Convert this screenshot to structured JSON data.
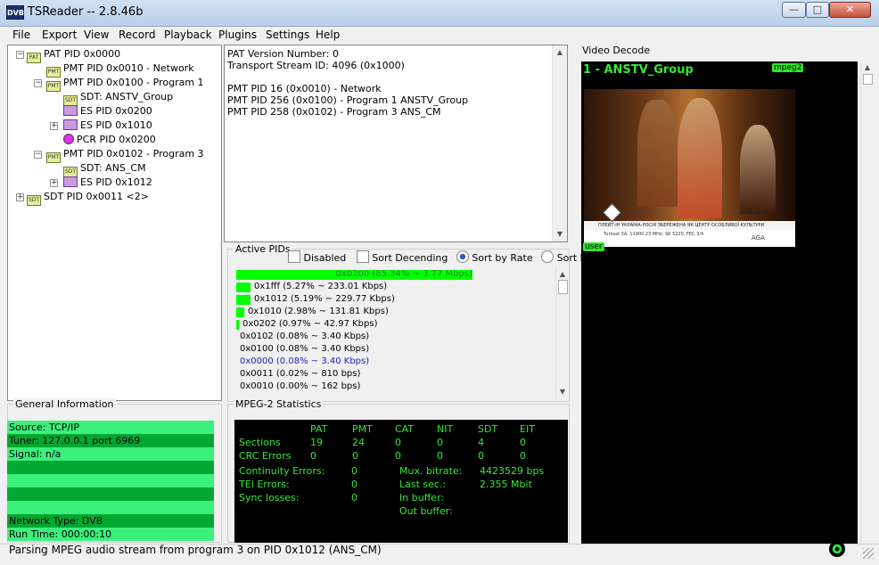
{
  "window": {
    "title": "TSReader -- 2.8.46b",
    "icon_text": "DVB"
  },
  "menu": [
    "File",
    "Export",
    "View",
    "Record",
    "Playback",
    "Plugins",
    "Settings",
    "Help"
  ],
  "tree": [
    {
      "label": "PAT PID 0x0000",
      "icon": "PAT"
    },
    {
      "label": "PMT PID 0x0010 - Network",
      "icon": "PMT"
    },
    {
      "label": "PMT PID 0x0100 - Program 1",
      "icon": "PMT"
    },
    {
      "label": "SDT: ANSTV_Group",
      "icon": "SDT"
    },
    {
      "label": "ES PID 0x0200",
      "icon": "ES"
    },
    {
      "label": "ES PID 0x1010",
      "icon": "ES"
    },
    {
      "label": "PCR PID 0x0200",
      "icon": "PCR"
    },
    {
      "label": "PMT PID 0x0102 - Program 3",
      "icon": "PMT"
    },
    {
      "label": "SDT: ANS_CM",
      "icon": "SDT"
    },
    {
      "label": "ES PID 0x1012",
      "icon": "ES"
    },
    {
      "label": "SDT PID 0x0011 <2>",
      "icon": "SDT"
    }
  ],
  "info": [
    "PAT Version Number: 0",
    "Transport Stream ID: 4096 (0x1000)",
    "",
    "PMT PID 16 (0x0010) - Network",
    "PMT PID 256 (0x0100) - Program 1 ANSTV_Group",
    "PMT PID 258 (0x0102) - Program 3 ANS_CM"
  ],
  "active_pids": {
    "title": "Active PIDs",
    "disabled_label": "Disabled",
    "sort_desc_label": "Sort Decending",
    "sort_rate_label": "Sort by Rate",
    "sort_pid_label": "Sort by PID",
    "rows": [
      {
        "label": "0x0200 (85.34% ~ 3.77 Mbps)",
        "percent": 85.34
      },
      {
        "label": "0x1fff (5.27% ~ 233.01 Kbps)",
        "percent": 5.27
      },
      {
        "label": "0x1012 (5.19% ~ 229.77 Kbps)",
        "percent": 5.19
      },
      {
        "label": "0x1010 (2.98% ~ 131.81 Kbps)",
        "percent": 2.98
      },
      {
        "label": "0x0202 (0.97% ~ 42.97 Kbps)",
        "percent": 0.97
      },
      {
        "label": "0x0102 (0.08% ~ 3.40 Kbps)",
        "percent": 0.08
      },
      {
        "label": "0x0100 (0.08% ~ 3.40 Kbps)",
        "percent": 0.08
      },
      {
        "label": "0x0000 (0.08% ~ 3.40 Kbps)",
        "percent": 0.08,
        "color": "#1c1cc8"
      },
      {
        "label": "0x0011 (0.02% ~ 810 bps)",
        "percent": 0.02
      },
      {
        "label": "0x0010 (0.00% ~ 162 bps)",
        "percent": 0.0
      }
    ]
  },
  "general": {
    "title": "General Information",
    "rows": [
      "Source: TCP/IP",
      "Tuner: 127.0.0.1 port 6969",
      "Signal: n/a",
      "",
      "",
      "",
      "",
      "Network Type: DVB",
      "Run Time: 000:00:10"
    ]
  },
  "mpeg": {
    "title": "MPEG-2 Statistics",
    "headers": [
      "PAT",
      "PMT",
      "CAT",
      "NIT",
      "SDT",
      "EIT"
    ],
    "sections_label": "Sections",
    "sections": [
      "19",
      "24",
      "0",
      "0",
      "4",
      "0"
    ],
    "crc_label": "CRC Errors",
    "crc": [
      "0",
      "0",
      "0",
      "0",
      "0",
      "0"
    ],
    "continuity_label": "Continuity Errors:",
    "continuity": "0",
    "tei_label": "TEI Errors:",
    "tei": "0",
    "sync_label": "Sync losses:",
    "sync": "0",
    "mux_label": "Mux. bitrate:",
    "mux": "4423529 bps",
    "last_label": "Last sec.:",
    "last": "2.355 Mbit",
    "inbuf_label": "In buffer:",
    "outbuf_label": "Out buffer:"
  },
  "video": {
    "title": "Video Decode",
    "channel": "1 - ANSTV_Group",
    "codec_badge": "mpeg2",
    "user_badge": "user",
    "ticker": "ПЛЕЙТ-ІН УКРАЇНА-РОСІЯ ЗБЕРЕЖЕНА ЯК ЦЕНТР ОСОБЛИВОЇ КУЛЬТУРИ",
    "caption": "Turksat 3A, 11900 23 MHz; SR 5220, FEC 3/4",
    "logo": "AGA"
  },
  "status": "Parsing MPEG audio stream from program 3 on PID 0x1012 (ANS_CM)"
}
